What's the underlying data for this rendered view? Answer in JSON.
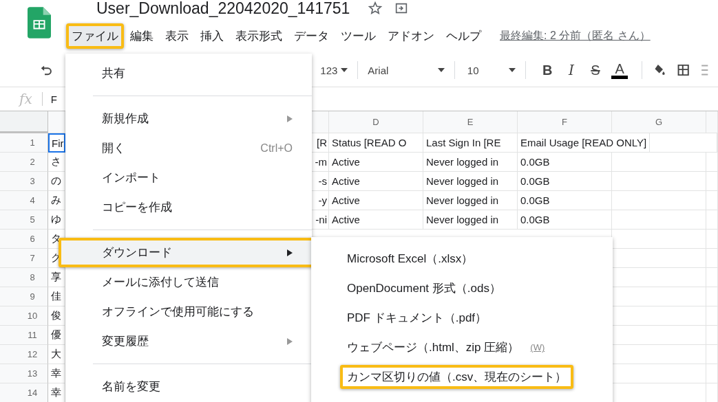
{
  "title": "User_Download_22042020_141751",
  "menubar": [
    {
      "label": "ファイル",
      "selected": true,
      "highlighted": true
    },
    {
      "label": "編集",
      "selected": false,
      "highlighted": false
    },
    {
      "label": "表示",
      "selected": false,
      "highlighted": false
    },
    {
      "label": "挿入",
      "selected": false,
      "highlighted": false
    },
    {
      "label": "表示形式",
      "selected": false,
      "highlighted": false
    },
    {
      "label": "データ",
      "selected": false,
      "highlighted": false
    },
    {
      "label": "ツール",
      "selected": false,
      "highlighted": false
    },
    {
      "label": "アドオン",
      "selected": false,
      "highlighted": false
    },
    {
      "label": "ヘルプ",
      "selected": false,
      "highlighted": false
    }
  ],
  "last_edit": "最終編集: 2 分前（匿名 さん）",
  "toolbar": {
    "number_format": "123",
    "font": "Arial",
    "font_size": "10",
    "format_buttons": [
      {
        "label": "B",
        "kind": "bold"
      },
      {
        "label": "I",
        "kind": "italic"
      },
      {
        "label": "S",
        "kind": "strike"
      },
      {
        "label": "A",
        "kind": "color"
      }
    ]
  },
  "formula_bar": {
    "fx": "fx",
    "value": "F"
  },
  "columns": [
    "D",
    "E",
    "F",
    "G"
  ],
  "rows": [
    {
      "number": "1",
      "a": "Fir",
      "c": "[R",
      "cells": [
        "Status [READ O",
        "Last Sign In [RE",
        "Email Usage [READ ONLY]"
      ]
    },
    {
      "number": "2",
      "a": "さ",
      "c": "-m",
      "cells": [
        "Active",
        "Never logged in",
        "0.0GB"
      ]
    },
    {
      "number": "3",
      "a": "の",
      "c": "-s",
      "cells": [
        "Active",
        "Never logged in",
        "0.0GB"
      ]
    },
    {
      "number": "4",
      "a": "み",
      "c": "-y",
      "cells": [
        "Active",
        "Never logged in",
        "0.0GB"
      ]
    },
    {
      "number": "5",
      "a": "ゆ",
      "c": "-ni",
      "cells": [
        "Active",
        "Never logged in",
        "0.0GB"
      ]
    },
    {
      "number": "6",
      "a": "タ"
    },
    {
      "number": "7",
      "a": "ク"
    },
    {
      "number": "8",
      "a": "享"
    },
    {
      "number": "9",
      "a": "佳"
    },
    {
      "number": "10",
      "a": "俊"
    },
    {
      "number": "11",
      "a": "優"
    },
    {
      "number": "12",
      "a": "大"
    },
    {
      "number": "13",
      "a": "幸"
    },
    {
      "number": "14",
      "a": "幸"
    }
  ],
  "file_menu": [
    {
      "kind": "item",
      "label": "共有",
      "submenu": false,
      "selected": false,
      "highlighted": false
    },
    {
      "kind": "divider"
    },
    {
      "kind": "item",
      "label": "新規作成",
      "submenu": true,
      "selected": false,
      "highlighted": false
    },
    {
      "kind": "item",
      "label": "開く",
      "shortcut": "Ctrl+O",
      "submenu": false,
      "selected": false,
      "highlighted": false
    },
    {
      "kind": "item",
      "label": "インポート",
      "submenu": false,
      "selected": false,
      "highlighted": false
    },
    {
      "kind": "item",
      "label": "コピーを作成",
      "submenu": false,
      "selected": false,
      "highlighted": false
    },
    {
      "kind": "divider"
    },
    {
      "kind": "item",
      "label": "ダウンロード",
      "submenu": true,
      "selected": true,
      "highlighted": true
    },
    {
      "kind": "item",
      "label": "メールに添付して送信",
      "submenu": false,
      "selected": false,
      "highlighted": false
    },
    {
      "kind": "item",
      "label": "オフラインで使用可能にする",
      "submenu": false,
      "selected": false,
      "highlighted": false
    },
    {
      "kind": "item",
      "label": "変更履歴",
      "submenu": true,
      "selected": false,
      "highlighted": false
    },
    {
      "kind": "divider"
    },
    {
      "kind": "item",
      "label": "名前を変更",
      "submenu": false,
      "selected": false,
      "highlighted": false
    }
  ],
  "download_menu": [
    {
      "label": "Microsoft Excel（.xlsx）",
      "highlighted": false
    },
    {
      "label": "OpenDocument 形式（.ods）",
      "highlighted": false
    },
    {
      "label": "PDF ドキュメント（.pdf）",
      "highlighted": false
    },
    {
      "label": "ウェブページ（.html、zip 圧縮）",
      "hint": "(W)",
      "highlighted": false
    },
    {
      "label": "カンマ区切りの値（.csv、現在のシート）",
      "highlighted": true
    }
  ]
}
